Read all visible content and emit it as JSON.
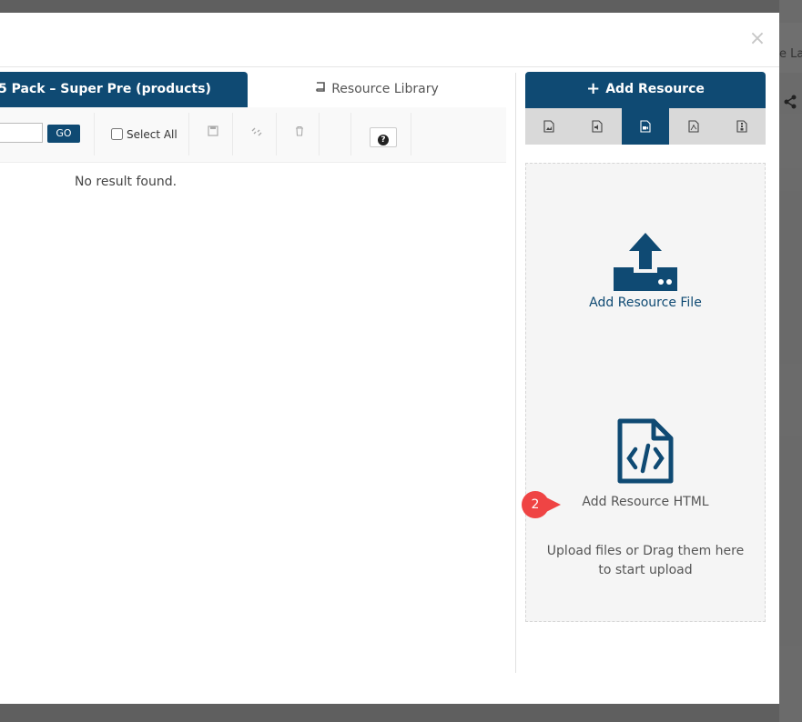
{
  "background": {
    "label_fragment": "e La"
  },
  "modal": {
    "close_glyph": "×",
    "tabs": {
      "active_label": "5 Pack – Super Pre (products)",
      "library_label": "Resource Library"
    },
    "toolbar": {
      "search_value": "",
      "go_label": "GO",
      "select_all_label": "Select All",
      "icons": [
        "save-icon",
        "unlink-icon",
        "trash-icon"
      ],
      "help_glyph": "?"
    },
    "results": {
      "empty_message": "No result found."
    },
    "right_panel": {
      "add_resource_label": "Add Resource",
      "type_tabs": [
        {
          "name": "image-file-icon",
          "active": false
        },
        {
          "name": "audio-file-icon",
          "active": false
        },
        {
          "name": "video-file-icon",
          "active": true
        },
        {
          "name": "pdf-file-icon",
          "active": false
        },
        {
          "name": "archive-file-icon",
          "active": false
        }
      ],
      "dropzone": {
        "file_label": "Add Resource File",
        "html_label": "Add Resource HTML",
        "hint": "Upload files or Drag them here to start upload"
      },
      "step_badge": "2"
    }
  },
  "colors": {
    "primary": "#0f4a73",
    "badge": "#ef4444",
    "overlay": "#5f5f5f"
  }
}
